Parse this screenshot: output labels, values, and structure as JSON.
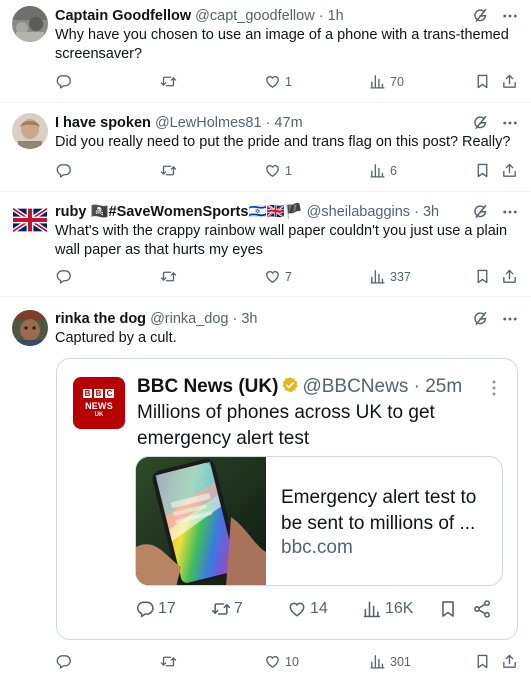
{
  "tweets": [
    {
      "name": "Captain Goodfellow",
      "handle": "@capt_goodfellow",
      "time": "· 1h",
      "text": "Why have you chosen to use an image of a phone with a trans-themed screensaver?",
      "replies": "",
      "reposts": "",
      "likes": "1",
      "views": "70"
    },
    {
      "name": "I have spoken",
      "handle": "@LewHolmes81",
      "time": "· 47m",
      "text": "Did you really need to put the pride and trans flag on this post? Really?",
      "replies": "",
      "reposts": "",
      "likes": "1",
      "views": "6"
    },
    {
      "name": "ruby 🏴‍☠️#SaveWomenSports🇮🇱🇬🇧🏴",
      "name_plain": "ruby",
      "name_tag": "#SaveWomenSports",
      "handle": "@sheilabaggins",
      "time": "· 3h",
      "text": "What's with the crappy rainbow wall paper couldn't you just use a plain wall paper as that hurts my eyes",
      "replies": "",
      "reposts": "",
      "likes": "7",
      "views": "337"
    },
    {
      "name": "rinka the dog",
      "handle": "@rinka_dog",
      "time": "· 3h",
      "text": "Captured by a cult.",
      "replies": "",
      "reposts": "",
      "likes": "10",
      "views": "301"
    }
  ],
  "quoted": {
    "name": "BBC News (UK)",
    "handle": "@BBCNews",
    "time": "· 25m",
    "logo_blocks": [
      "B",
      "B",
      "C"
    ],
    "logo_text": "NEWS",
    "logo_sub": "UK",
    "text": "Millions of phones across UK to get emergency alert test",
    "card_title": "Emergency alert test to be sent to millions of ...",
    "card_domain": "bbc.com",
    "replies": "17",
    "reposts": "7",
    "likes": "14",
    "views": "16K"
  },
  "colors": {
    "text": "#0f1419",
    "secondary": "#536471",
    "border": "#cfd9de",
    "bbc_red": "#b80000",
    "verified_gold": "#e2b719"
  },
  "icons": [
    "grok-icon",
    "more-icon",
    "reply-icon",
    "repost-icon",
    "like-icon",
    "views-icon",
    "bookmark-icon",
    "share-icon",
    "verified-badge-icon"
  ]
}
